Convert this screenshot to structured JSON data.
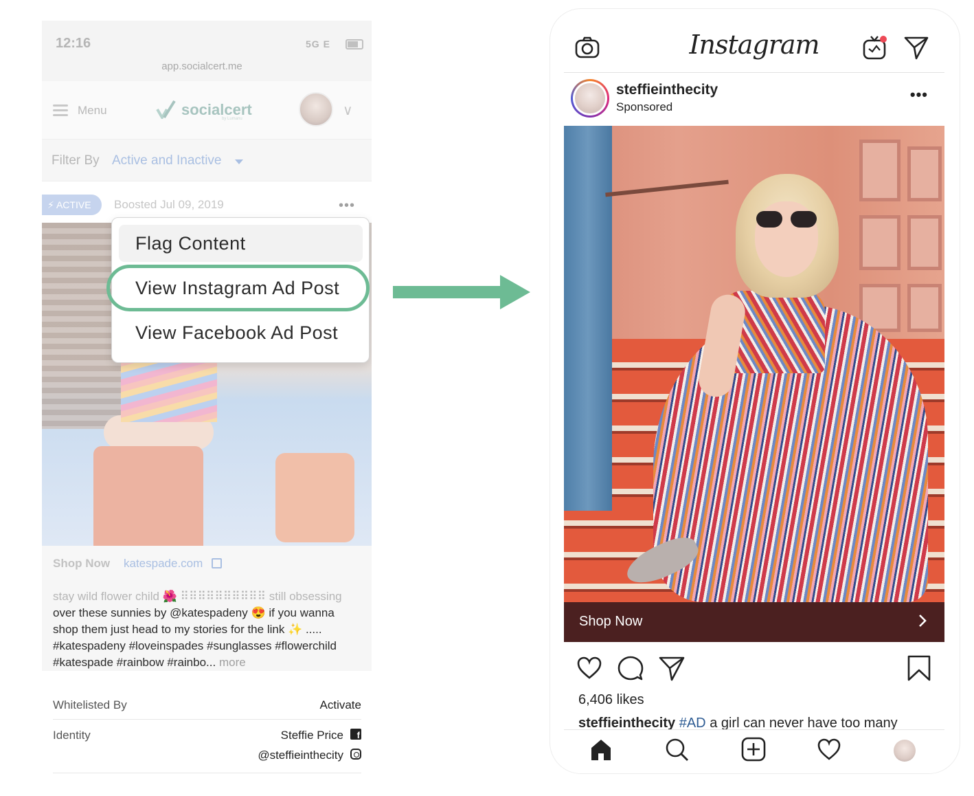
{
  "left_app": {
    "status": {
      "time": "12:16",
      "network": "5G E",
      "url": "app.socialcert.me"
    },
    "nav": {
      "menu_label": "Menu",
      "brand": "socialcert",
      "brand_sub": "by Lumanu"
    },
    "filter": {
      "label": "Filter By",
      "value": "Active and Inactive"
    },
    "card": {
      "badge": "ACTIVE",
      "boosted": "Boosted Jul 09, 2019",
      "menu": {
        "flag": "Flag Content",
        "view_instagram": "View Instagram Ad Post",
        "view_facebook": "View Facebook Ad Post"
      },
      "shop_label": "Shop Now",
      "shop_link": "katespade.com",
      "caption_faded": "stay wild flower child 🌺 ⠿⠿⠿⠿⠿⠿⠿⠿⠿⠿ still obsessing",
      "caption_text": "over these sunnies by @katespadeny 😍 if you wanna shop them just head to my stories for the link ✨ ..... #katespadeny #loveinspades #sunglasses #flowerchild #katespade #rainbow #rainbo...",
      "caption_more": "more"
    },
    "details": {
      "whitelisted_label": "Whitelisted By",
      "whitelisted_action": "Activate",
      "identity_label": "Identity",
      "identity_name": "Steffie Price",
      "identity_handle": "@steffieinthecity"
    }
  },
  "instagram": {
    "logo": "Instagram",
    "username": "steffieinthecity",
    "sponsored": "Sponsored",
    "shop_now": "Shop Now",
    "likes": "6,406 likes",
    "caption_user": "steffieinthecity",
    "caption_tag": "#AD",
    "caption_text": "a girl can never have too many"
  },
  "colors": {
    "highlight": "#6dbb94",
    "arrow": "#6dbb94",
    "shop_bar": "#4b2020",
    "link": "#a9bfe2"
  }
}
